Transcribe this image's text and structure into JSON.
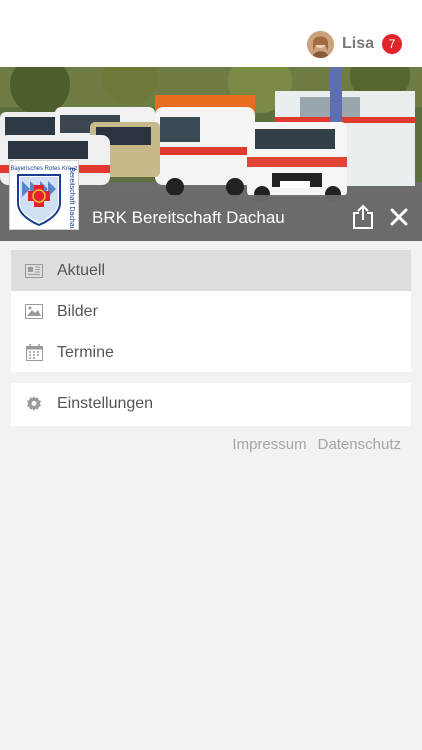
{
  "user": {
    "name": "Lisa",
    "notification_count": "7"
  },
  "header": {
    "org_title": "BRK Bereitschaft Dachau",
    "share_icon": "share-icon",
    "close_icon": "close-icon"
  },
  "logo": {
    "top_text": "Bayerisches Rotes Kreuz",
    "side_text": "Bereitschaft Dachau"
  },
  "menu": {
    "primary": [
      {
        "label": "Aktuell",
        "icon": "newspaper-icon",
        "active": true
      },
      {
        "label": "Bilder",
        "icon": "image-icon",
        "active": false
      },
      {
        "label": "Termine",
        "icon": "calendar-icon",
        "active": false
      }
    ],
    "secondary": [
      {
        "label": "Einstellungen",
        "icon": "gear-icon",
        "active": false
      }
    ]
  },
  "footer": {
    "impressum": "Impressum",
    "datenschutz": "Datenschutz"
  },
  "colors": {
    "badge": "#e0242b",
    "titlebar": "#6c6c6c",
    "active_item": "#dedede"
  }
}
